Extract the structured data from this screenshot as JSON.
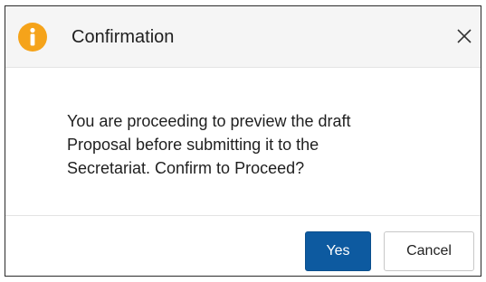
{
  "dialog": {
    "title": "Confirmation",
    "icon": "info-icon",
    "message_lines": [
      "You are proceeding to preview the draft",
      "Proposal before submitting it to the",
      "Secretariat. Confirm to Proceed?"
    ],
    "buttons": {
      "yes_label": "Yes",
      "cancel_label": "Cancel"
    },
    "close_icon": "close-icon"
  },
  "colors": {
    "info_icon": "#f5a31a",
    "primary_button": "#0d5aa0",
    "header_background": "#f5f5f5"
  }
}
